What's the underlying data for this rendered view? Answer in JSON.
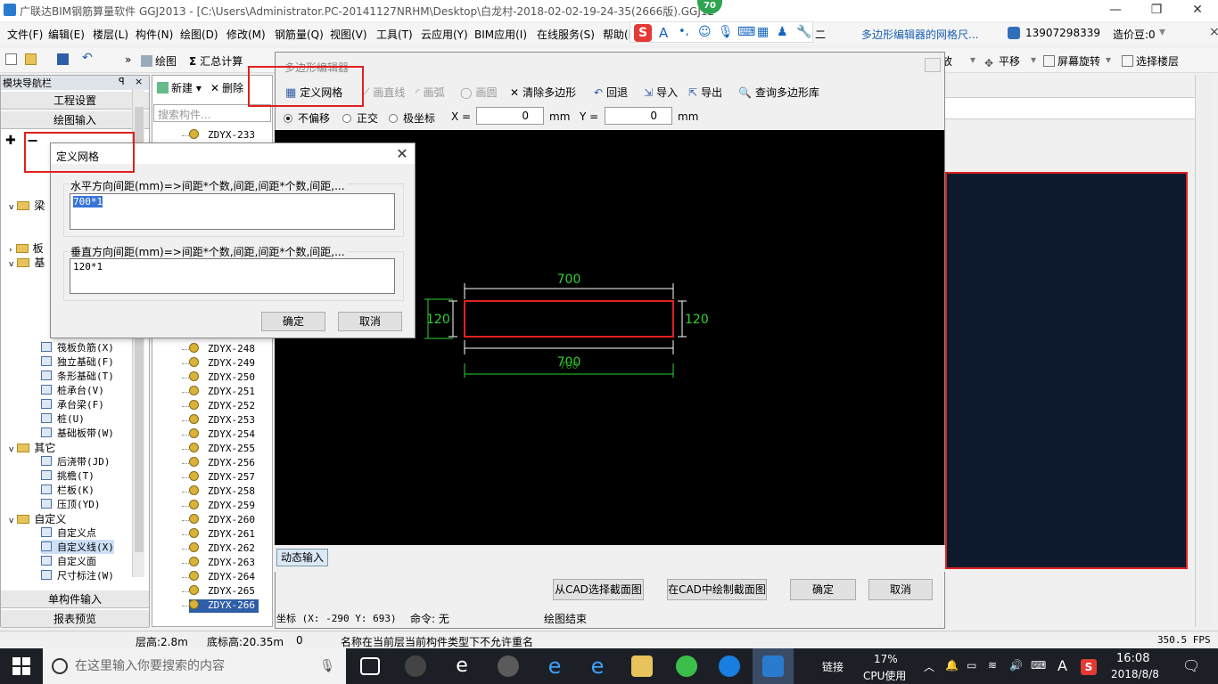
{
  "window": {
    "title": "广联达BIM钢筋算量软件 GGJ2013 - [C:\\Users\\Administrator.PC-20141127NRHM\\Desktop\\白龙村-2018-02-02-19-24-35(2666版).GGJ12",
    "badge": "70",
    "minimize": "—",
    "maximize": "❐",
    "close": "✕"
  },
  "menu": {
    "items": [
      "文件(F)",
      "编辑(E)",
      "楼层(L)",
      "构件(N)",
      "绘图(D)",
      "修改(M)",
      "钢筋量(Q)",
      "视图(V)",
      "工具(T)",
      "云应用(Y)",
      "BIM应用(I)",
      "在线服务(S)",
      "帮助(H)"
    ],
    "right_tip": "多边形编辑器的网格尺...",
    "phone": "13907298339",
    "beans": "造价豆:0",
    "ime_text": "二"
  },
  "toolbar": {
    "draw": "绘图",
    "sum": "汇总计算",
    "zoom": "缩放",
    "pan": "平移",
    "rotate": "屏幕旋转",
    "select_floor": "选择楼层"
  },
  "nav": {
    "header": "模块导航栏",
    "pin": "ꟼ",
    "close": "×",
    "project_settings": "工程设置",
    "drawing_input": "绘图输入",
    "single_input": "单构件输入",
    "report_preview": "报表预览",
    "tree": [
      {
        "label": "梁",
        "type": "group"
      },
      {
        "label": "板",
        "type": "group"
      },
      {
        "label": "基",
        "type": "group"
      },
      {
        "label": "筏板负筋(X)",
        "type": "item"
      },
      {
        "label": "独立基础(F)",
        "type": "item"
      },
      {
        "label": "条形基础(T)",
        "type": "item"
      },
      {
        "label": "桩承台(V)",
        "type": "item"
      },
      {
        "label": "承台梁(F)",
        "type": "item"
      },
      {
        "label": "桩(U)",
        "type": "item"
      },
      {
        "label": "基础板带(W)",
        "type": "item"
      },
      {
        "label": "其它",
        "type": "group"
      },
      {
        "label": "后浇带(JD)",
        "type": "item"
      },
      {
        "label": "挑檐(T)",
        "type": "item"
      },
      {
        "label": "栏板(K)",
        "type": "item"
      },
      {
        "label": "压顶(YD)",
        "type": "item"
      },
      {
        "label": "自定义",
        "type": "group"
      },
      {
        "label": "自定义点",
        "type": "item"
      },
      {
        "label": "自定义线(X)",
        "type": "item"
      },
      {
        "label": "自定义面",
        "type": "item"
      },
      {
        "label": "尺寸标注(W)",
        "type": "item"
      }
    ]
  },
  "components": {
    "new": "新建",
    "delete": "删除",
    "search_placeholder": "搜索构件...",
    "list": [
      "ZDYX-233",
      "ZDYX-248",
      "ZDYX-249",
      "ZDYX-250",
      "ZDYX-251",
      "ZDYX-252",
      "ZDYX-253",
      "ZDYX-254",
      "ZDYX-255",
      "ZDYX-256",
      "ZDYX-257",
      "ZDYX-258",
      "ZDYX-259",
      "ZDYX-260",
      "ZDYX-261",
      "ZDYX-262",
      "ZDYX-263",
      "ZDYX-264",
      "ZDYX-265",
      "ZDYX-266"
    ],
    "selected": "ZDYX-266"
  },
  "poly_editor": {
    "title": "多边形编辑器",
    "define_grid": "定义网格",
    "line": "画直线",
    "arc": "画弧",
    "circle": "画圆",
    "clear": "清除多边形",
    "undo": "回退",
    "import": "导入",
    "export": "导出",
    "query_lib": "查询多边形库",
    "opt_none": "不偏移",
    "opt_ortho": "正交",
    "opt_polar": "极坐标",
    "x_label": "X =",
    "x_value": "0",
    "y_label": "Y =",
    "y_value": "0",
    "unit": "mm",
    "dim_top": "700",
    "dim_bottom": "700",
    "dim_bottom_sub": "700",
    "dim_right": "120",
    "dim_left": "120",
    "dynamic_input": "动态输入",
    "from_cad": "从CAD选择截面图",
    "draw_in_cad": "在CAD中绘制截面图",
    "ok": "确定",
    "cancel": "取消",
    "coord": "坐标 (X: -290 Y: 693)",
    "command": "命令: 无",
    "status": "绘图结束"
  },
  "grid_dialog": {
    "title": "定义网格",
    "close": "✕",
    "h_label": "水平方向间距(mm)=>间距*个数,间距,间距*个数,间距,...",
    "h_value": "700*1",
    "v_label": "垂直方向间距(mm)=>间距*个数,间距,间距*个数,间距,...",
    "v_value": "120*1",
    "ok": "确定",
    "cancel": "取消"
  },
  "statusbar": {
    "floor_height": "层高:2.8m",
    "base_height": "底标高:20.35m",
    "zero": "0",
    "message": "名称在当前层当前构件类型下不允许重名",
    "fps": "350.5 FPS"
  },
  "taskbar": {
    "search_placeholder": "在这里输入你要搜索的内容",
    "link": "链接",
    "cpu_pct": "17%",
    "cpu_label": "CPU使用",
    "ime": "A",
    "time": "16:08",
    "date": "2018/8/8"
  },
  "colors": {
    "highlight_red": "#e02020",
    "dim_green": "#30d030",
    "selection_blue": "#2f5ea8"
  }
}
